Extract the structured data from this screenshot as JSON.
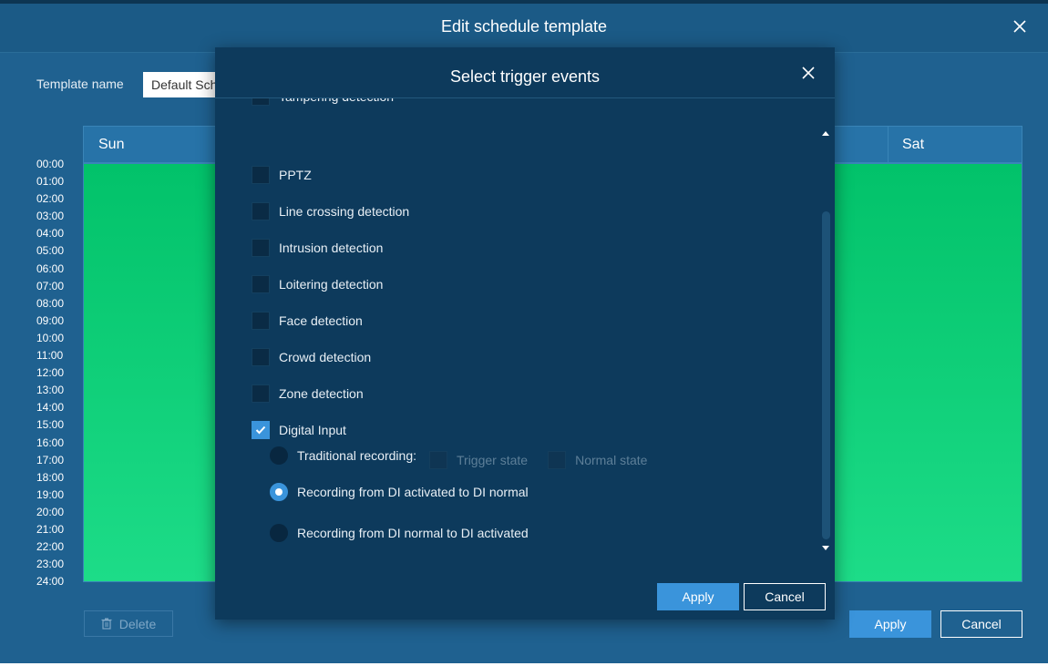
{
  "outer": {
    "title": "Edit schedule template",
    "template_label": "Template name",
    "template_value": "Default Schedule",
    "days": {
      "first": "Sun",
      "last": "Sat"
    },
    "hours": [
      "00:00",
      "01:00",
      "02:00",
      "03:00",
      "04:00",
      "05:00",
      "06:00",
      "07:00",
      "08:00",
      "09:00",
      "10:00",
      "11:00",
      "12:00",
      "13:00",
      "14:00",
      "15:00",
      "16:00",
      "17:00",
      "18:00",
      "19:00",
      "20:00",
      "21:00",
      "22:00",
      "23:00",
      "24:00"
    ],
    "delete_label": "Delete",
    "apply_label": "Apply",
    "cancel_label": "Cancel"
  },
  "modal": {
    "title": "Select trigger events",
    "events": [
      {
        "label": "Tampering detection",
        "checked": false
      },
      {
        "label": "PPTZ",
        "checked": false
      },
      {
        "label": "Line crossing detection",
        "checked": false
      },
      {
        "label": "Intrusion detection",
        "checked": false
      },
      {
        "label": "Loitering detection",
        "checked": false
      },
      {
        "label": "Face detection",
        "checked": false
      },
      {
        "label": "Crowd detection",
        "checked": false
      },
      {
        "label": "Zone detection",
        "checked": false
      },
      {
        "label": "Digital Input",
        "checked": true
      }
    ],
    "di": {
      "traditional_label": "Traditional recording:",
      "trigger_state_label": "Trigger state",
      "normal_state_label": "Normal state",
      "activated_to_normal_label": "Recording from DI activated to DI normal",
      "normal_to_activated_label": "Recording from DI normal to DI activated",
      "selected": "activated_to_normal"
    },
    "apply_label": "Apply",
    "cancel_label": "Cancel"
  },
  "colors": {
    "accent": "#3a94db",
    "schedule_fill": "#02c26a",
    "modal_bg": "#0d3a5c",
    "page_bg": "#1f6190"
  }
}
